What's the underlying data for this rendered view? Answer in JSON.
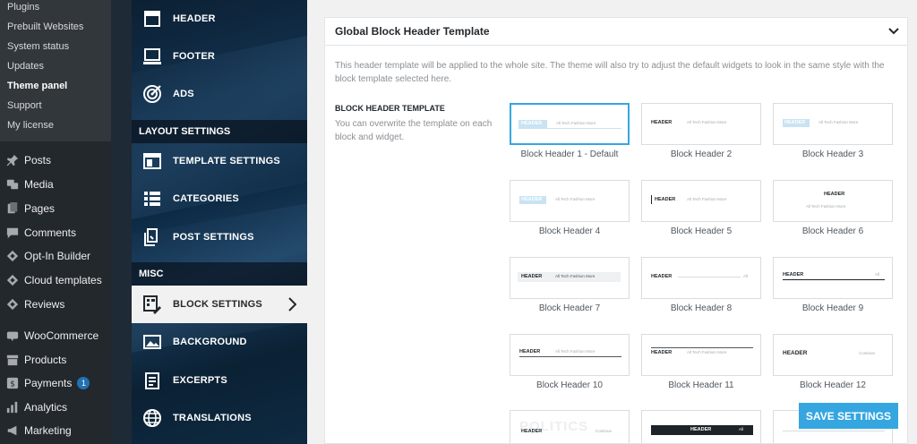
{
  "wp_menu": {
    "submenu": [
      "Plugins",
      "Prebuilt Websites",
      "System status",
      "Updates",
      "Theme panel",
      "Support",
      "My license"
    ],
    "active_sub": "Theme panel",
    "items": [
      {
        "label": "Posts",
        "icon": "pin-icon"
      },
      {
        "label": "Media",
        "icon": "media-icon"
      },
      {
        "label": "Pages",
        "icon": "pages-icon"
      },
      {
        "label": "Comments",
        "icon": "comment-icon"
      },
      {
        "label": "Opt-In Builder",
        "icon": "optin-icon"
      },
      {
        "label": "Cloud templates",
        "icon": "cloud-icon"
      },
      {
        "label": "Reviews",
        "icon": "reviews-icon"
      },
      {
        "label": "WooCommerce",
        "icon": "woo-icon"
      },
      {
        "label": "Products",
        "icon": "box-icon"
      },
      {
        "label": "Payments",
        "icon": "dollar-icon",
        "badge": "1"
      },
      {
        "label": "Analytics",
        "icon": "chart-icon"
      },
      {
        "label": "Marketing",
        "icon": "megaphone-icon"
      }
    ]
  },
  "theme_nav": {
    "top_items": [
      {
        "label": "HEADER",
        "icon": "header-icon"
      },
      {
        "label": "FOOTER",
        "icon": "footer-icon"
      },
      {
        "label": "ADS",
        "icon": "target-icon"
      }
    ],
    "section_layout": "LAYOUT SETTINGS",
    "layout_items": [
      {
        "label": "TEMPLATE SETTINGS",
        "icon": "layout-icon"
      },
      {
        "label": "CATEGORIES",
        "icon": "list-icon"
      },
      {
        "label": "POST SETTINGS",
        "icon": "document-icon"
      }
    ],
    "section_misc": "MISC",
    "misc_items": [
      {
        "label": "BLOCK SETTINGS",
        "icon": "block-settings-icon",
        "active": true
      },
      {
        "label": "BACKGROUND",
        "icon": "image-icon"
      },
      {
        "label": "EXCERPTS",
        "icon": "excerpt-icon"
      },
      {
        "label": "TRANSLATIONS",
        "icon": "globe-icon"
      }
    ]
  },
  "panel": {
    "title": "Global Block Header Template",
    "description": "This header template will be applied to the whole site. The theme will also try to adjust the default widgets to look in the same style with the block template selected here.",
    "option_label": "BLOCK HEADER TEMPLATE",
    "option_desc": "You can overwrite the template on each block and widget.",
    "selected": "Block Header 1 - Default",
    "templates": [
      {
        "caption": "Block Header 1 - Default",
        "sample": "HEADER",
        "filters": "All  Tech  Fashion  More"
      },
      {
        "caption": "Block Header 2",
        "sample": "HEADER",
        "filters": "All  Tech  Fashion  More"
      },
      {
        "caption": "Block Header 3",
        "sample": "HEADER",
        "filters": "All  Tech  Fashion  More"
      },
      {
        "caption": "Block Header 4",
        "sample": "HEADER",
        "filters": "All  Tech  Fashion  More"
      },
      {
        "caption": "Block Header 5",
        "sample": "HEADER",
        "filters": "All  Tech  Fashion  More"
      },
      {
        "caption": "Block Header 6",
        "sample": "HEADER",
        "filters": "All  Tech  Fashion  More"
      },
      {
        "caption": "Block Header 7",
        "sample": "HEADER",
        "filters": "All  Tech  Fashion  More"
      },
      {
        "caption": "Block Header 8",
        "sample": "HEADER",
        "filters": "All"
      },
      {
        "caption": "Block Header 9",
        "sample": "HEADER",
        "filters": "All"
      },
      {
        "caption": "Block Header 10",
        "sample": "HEADER",
        "filters": "All  Tech  Fashion  More"
      },
      {
        "caption": "Block Header 11",
        "sample": "HEADER",
        "filters": "All  Tech  Fashion  More"
      },
      {
        "caption": "Block Header 12",
        "sample": "HEADER",
        "filters": "Continue"
      },
      {
        "caption": "",
        "sample": "HEADER",
        "filters": "Continue"
      },
      {
        "caption": "",
        "sample": "HEADER",
        "filters": "All"
      },
      {
        "caption": "",
        "sample": "",
        "filters": ""
      }
    ],
    "save_label": "SAVE SETTINGS"
  }
}
